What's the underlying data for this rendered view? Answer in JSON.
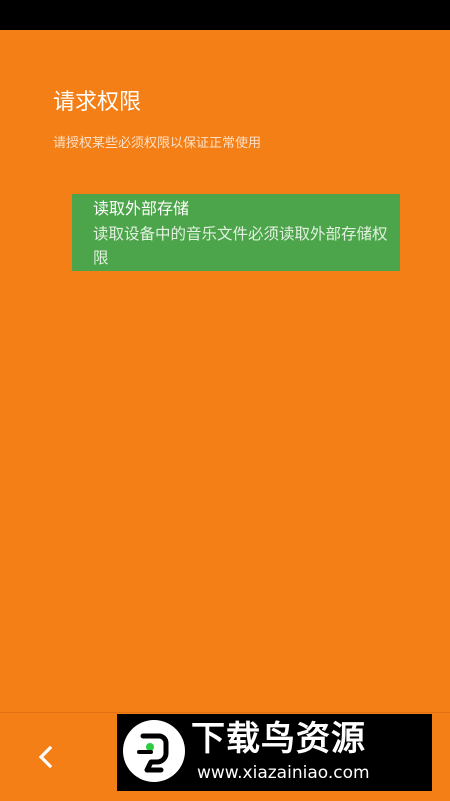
{
  "header": {
    "title": "请求权限",
    "subtitle": "请授权某些必须权限以保证正常使用"
  },
  "permissions": [
    {
      "name": "读取外部存储",
      "description": "读取设备中的音乐文件必须读取外部存储权限"
    }
  ],
  "bottom_bar": {
    "back_icon": "chevron-left-icon"
  },
  "watermark": {
    "title": "下载鸟资源",
    "url": "www.xiazainiao.com"
  },
  "colors": {
    "background": "#F47F17",
    "card": "#4CA54A",
    "status_bar": "#000000"
  }
}
